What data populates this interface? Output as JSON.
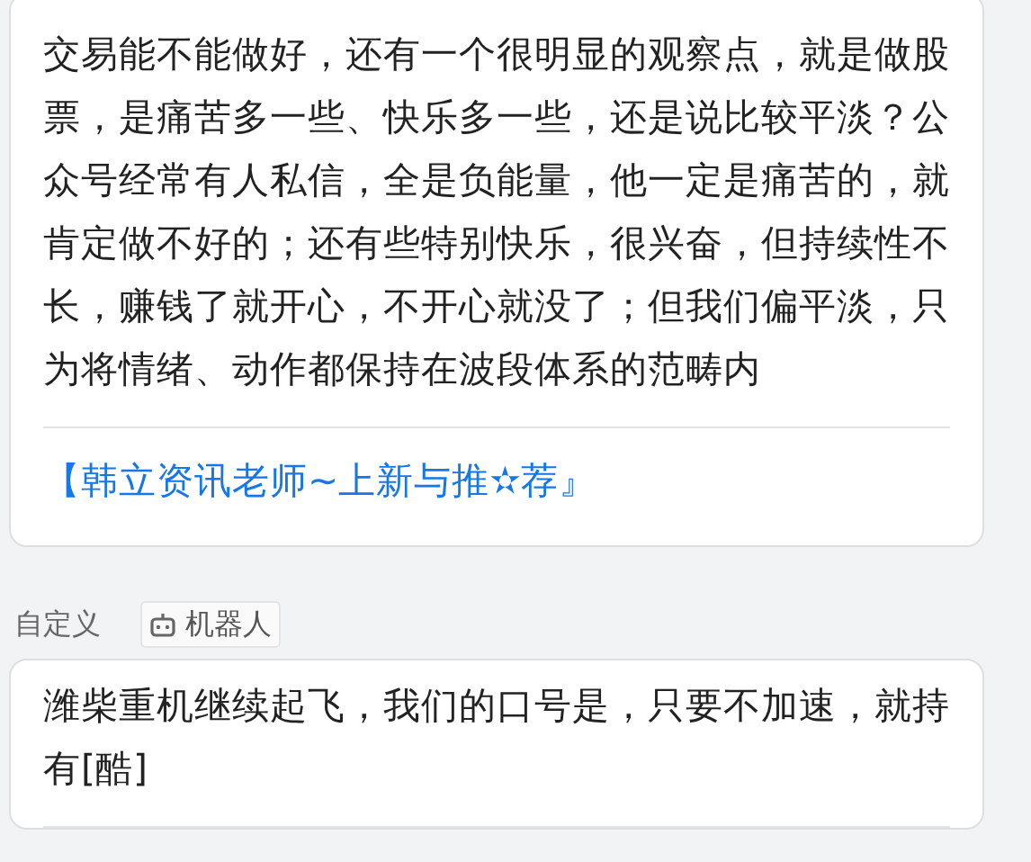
{
  "posts": [
    {
      "text": "交易能不能做好，还有一个很明显的观察点，就是做股票，是痛苦多一些、快乐多一些，还是说比较平淡？公众号经常有人私信，全是负能量，他一定是痛苦的，就肯定做不好的；还有些特别快乐，很兴奋，但持续性不长，赚钱了就开心，不开心就没了；但我们偏平淡，只为将情绪、动作都保持在波段体系的范畴内",
      "link": "【韩立资讯老师~上新与推✫荐』"
    },
    {
      "author": "自定义",
      "tag": "机器人",
      "text": "潍柴重机继续起飞，我们的口号是，只要不加速，就持有[酷]"
    }
  ]
}
